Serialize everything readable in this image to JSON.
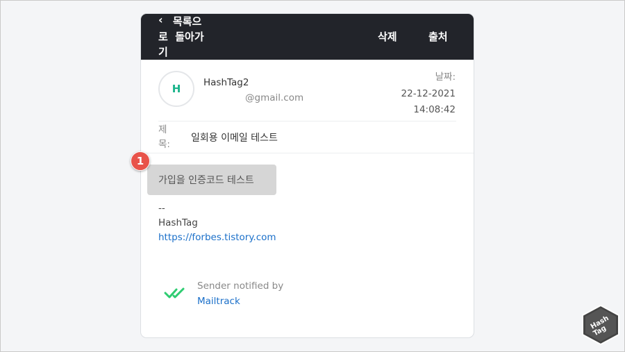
{
  "header": {
    "back_chevron": "‹",
    "back_label": "    목록으\n로  돌아가\n기",
    "delete_label": "삭제",
    "source_label": "출처"
  },
  "sender": {
    "avatar_initial": "H",
    "name": "HashTag2",
    "email": "@gmail.com"
  },
  "date": {
    "label": "날짜:",
    "value": "22-12-2021\n14:08:42"
  },
  "subject": {
    "label": "제\n목:",
    "value": "일회용 이메일 테스트"
  },
  "body": {
    "badge": "1",
    "highlight_text": "가입을 인증코드 테스트",
    "signature_dash": "--",
    "signature_name": "HashTag",
    "signature_link": "https://forbes.tistory.com"
  },
  "mailtrack": {
    "icon": "double-check-icon",
    "notified_text": "Sender notified by",
    "link_text": "Mailtrack",
    "color": "#2ecc71"
  },
  "watermark": {
    "logo_text": "Hash Tag"
  }
}
